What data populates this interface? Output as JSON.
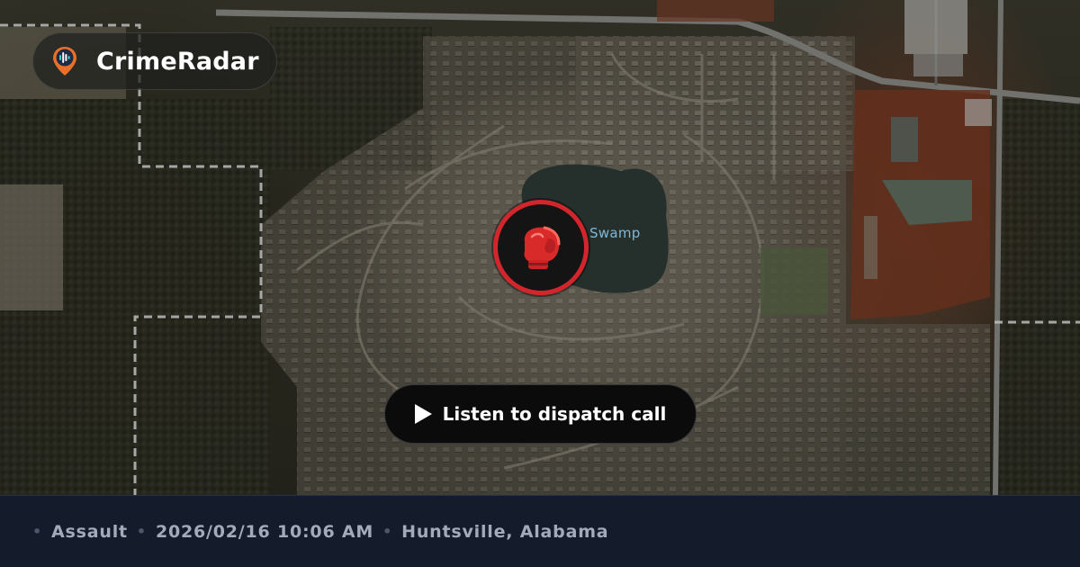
{
  "brand": {
    "name": "CrimeRadar",
    "logo_icon": "map-pin-radar-icon"
  },
  "map": {
    "place_label": "Swamp",
    "water_color": "#2e3a35",
    "boundary_color": "#e6e6e6"
  },
  "incident": {
    "icon": "boxing-glove-icon",
    "ring_color": "#d3262c"
  },
  "listen_button": {
    "label": "Listen to dispatch call",
    "icon": "play-icon"
  },
  "footer": {
    "type": "Assault",
    "datetime": "2026/02/16 10:06 AM",
    "location": "Huntsville, Alabama",
    "separator": "•"
  }
}
